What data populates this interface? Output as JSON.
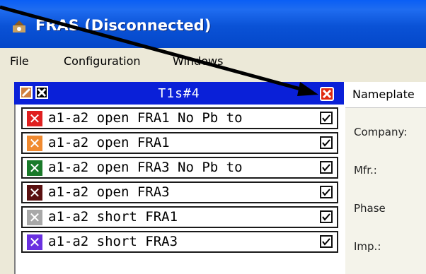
{
  "window": {
    "title": "FRAS (Disconnected)"
  },
  "menu": {
    "items": [
      "File",
      "Configuration",
      "Windows"
    ]
  },
  "panel": {
    "title": "T1s#4",
    "rows": [
      {
        "label": "a1-a2 open FRA1 No Pb to",
        "color": "#e02020"
      },
      {
        "label": "a1-a2 open FRA1",
        "color": "#f08a30"
      },
      {
        "label": "a1-a2 open FRA3 No Pb to",
        "color": "#1a7a2a"
      },
      {
        "label": "a1-a2 open FRA3",
        "color": "#5a1010"
      },
      {
        "label": "a1-a2 short FRA1",
        "color": "#a8a8a8"
      },
      {
        "label": "a1-a2 short FRA3",
        "color": "#6a30e0"
      }
    ]
  },
  "properties": {
    "header": "Nameplate",
    "fields": [
      "Company:",
      "Mfr.:",
      "Phase",
      "Imp.:"
    ]
  },
  "colors": {
    "titlebar": "#0a52d6",
    "panel_header": "#0a20d8",
    "menubar": "#ece9d8"
  }
}
